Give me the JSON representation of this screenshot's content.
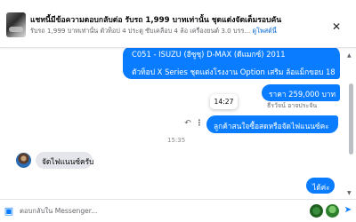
{
  "header": {
    "title": "แชทนี้มีข้อความตอบกลับต่อ รับรถ 1,999 บาทเท่านั้น ชุดแต่งจัดเต็มรอบคัน",
    "subtitle": "รับรถ 1,999 บาทเท่านั้น ตัวท็อป 4 ประตู ซับเคลือบ 4 ล้อ เครื่องยนต์ 3.0 บรร...",
    "view_more": "ดูโพสต์นี้"
  },
  "messages": {
    "car_line1": "C051 - ISUZU (อีซูซุ) D-MAX (ดีแมกซ์) 2011",
    "car_line2": "ตัวท็อป X Series ชุดแต่งโรงงาน Option เสริม ล้อแม็กขอบ 18",
    "price": "ราคา 259,000 บาท",
    "sender_name": "ธีรวัจน์ อาจประจัน",
    "hover_time": "14:27",
    "question": "ลูกค้าสนใจซื้อสดหรือจัดไฟแนนซ์คะ",
    "time_separator": "15:35",
    "customer_reply": "จัดไฟแนนซ์ครับ",
    "agent_reply": "ได้ค่ะ"
  },
  "composer": {
    "placeholder": "ตอบกลับใน Messenger..."
  },
  "icons": {
    "close": "close-icon",
    "reply": "reply-icon",
    "more": "more-icon",
    "image": "image-icon",
    "send": "send-icon"
  },
  "colors": {
    "accent": "#0a7cff",
    "incoming_bubble": "#e4e6eb",
    "link": "#0064d1"
  }
}
